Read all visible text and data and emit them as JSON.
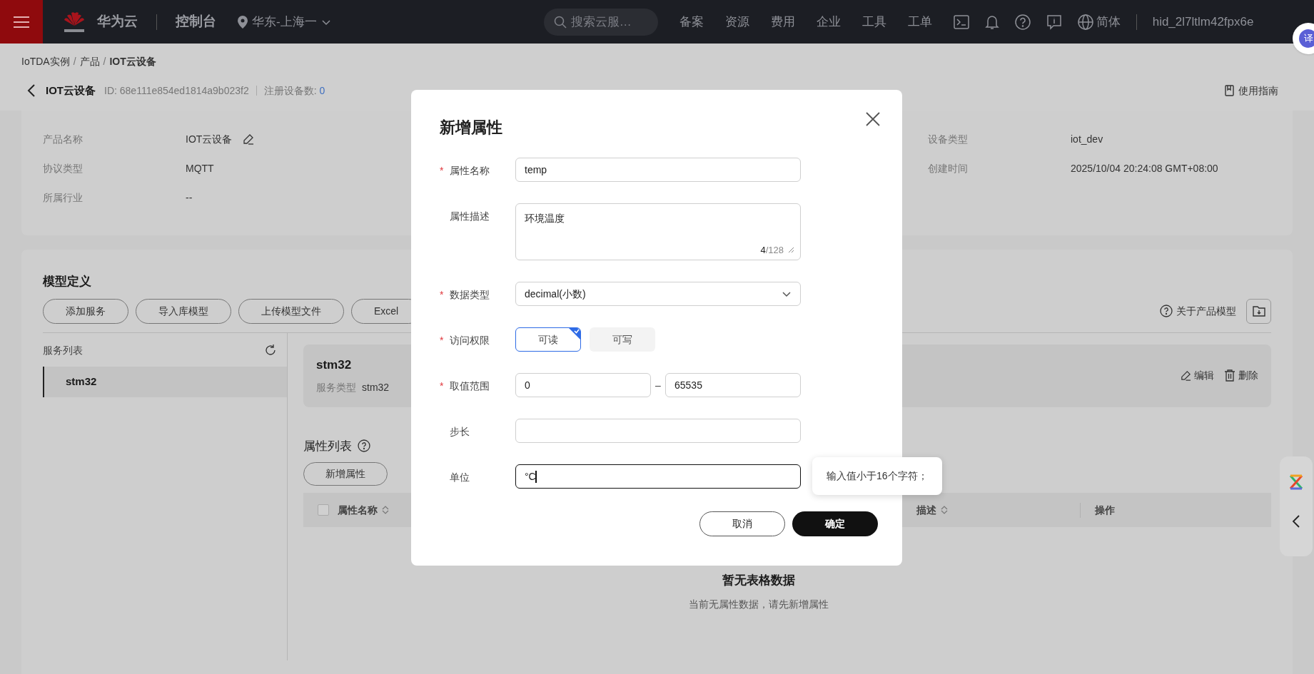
{
  "topbar": {
    "brand": "华为云",
    "console": "控制台",
    "region": "华东-上海一",
    "search_placeholder": "搜索云服…",
    "nav": [
      "备案",
      "资源",
      "费用",
      "企业",
      "工具",
      "工单"
    ],
    "language": "简体",
    "user": "hid_2l7ltlm42fpx6e",
    "translate": "译"
  },
  "breadcrumb": [
    "IoTDA实例",
    "产品",
    "IOT云设备"
  ],
  "breadcrumb_separator": "/",
  "header": {
    "title": "IOT云设备",
    "id": "ID: 68e111e854ed1814a9b023f2",
    "device_count_label": "注册设备数:",
    "device_count": "0",
    "guide": "使用指南"
  },
  "details": {
    "left": [
      {
        "label": "产品名称",
        "value": "IOT云设备",
        "editable": true
      },
      {
        "label": "协议类型",
        "value": "MQTT",
        "editable": false
      },
      {
        "label": "所属行业",
        "value": "--",
        "editable": false
      }
    ],
    "right": [
      {
        "label": "设备类型",
        "value": "iot_dev"
      },
      {
        "label": "创建时间",
        "value": "2025/10/04 20:24:08 GMT+08:00"
      }
    ]
  },
  "model": {
    "title": "模型定义",
    "buttons": [
      "添加服务",
      "导入库模型",
      "上传模型文件",
      "Excel"
    ],
    "about": "关于产品模型",
    "service_list": {
      "title": "服务列表",
      "items": [
        {
          "label": "stm32",
          "selected": true
        }
      ]
    },
    "service": {
      "name": "stm32",
      "type_label": "服务类型",
      "type": "stm32",
      "edit": "编辑",
      "delete": "删除"
    },
    "property_list": {
      "title": "属性列表",
      "add": "新增属性",
      "select_all_checked": false,
      "columns": [
        {
          "label": "属性名称",
          "sortable": true
        },
        {
          "label": "描述",
          "sortable": true
        },
        {
          "label": "操作",
          "sortable": false
        }
      ],
      "empty_title": "暂无表格数据",
      "empty_text": "当前无属性数据，请先新增属性"
    }
  },
  "dialog": {
    "title": "新增属性",
    "required_mark": "*",
    "fields": [
      {
        "kind": "text",
        "label": "属性名称",
        "required": true,
        "value": "temp",
        "focused": false
      },
      {
        "kind": "textarea",
        "label": "属性描述",
        "required": false,
        "value": "环境温度",
        "count": "4",
        "max": "/128"
      },
      {
        "kind": "select",
        "label": "数据类型",
        "required": true,
        "value": "decimal(小数)"
      },
      {
        "kind": "toggle",
        "label": "访问权限",
        "required": true,
        "options": [
          {
            "label": "可读",
            "selected": true
          },
          {
            "label": "可写",
            "selected": false
          }
        ]
      },
      {
        "kind": "range",
        "label": "取值范围",
        "required": true,
        "min": "0",
        "separator": "–",
        "max": "65535"
      },
      {
        "kind": "text",
        "label": "步长",
        "required": false,
        "focused": false
      },
      {
        "kind": "text",
        "label": "单位",
        "required": false,
        "value": "°C",
        "focused": true,
        "tooltip": "输入值小于16个字符；"
      }
    ],
    "cancel": "取消",
    "confirm": "确定"
  }
}
